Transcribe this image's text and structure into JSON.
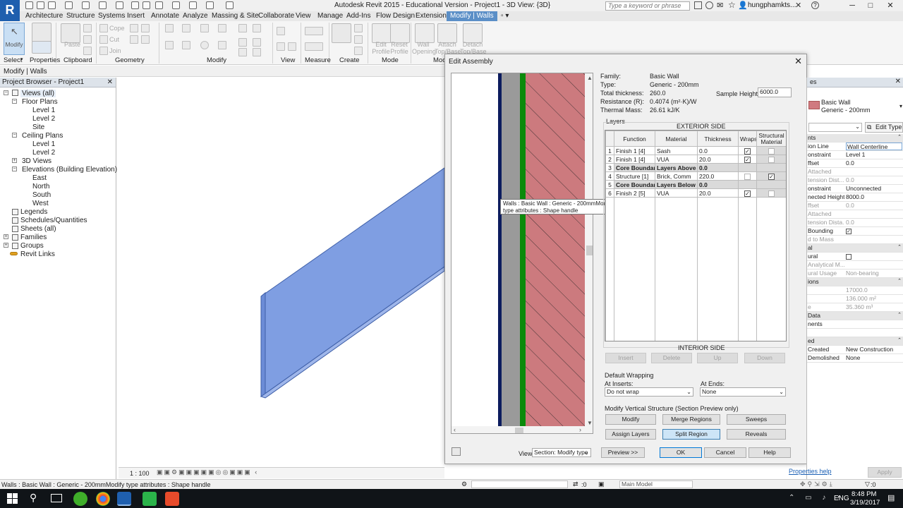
{
  "app": {
    "title": "Autodesk Revit 2015 - Educational Version -    Project1 - 3D View: {3D}",
    "search_placeholder": "Type a keyword or phrase",
    "user": "hungphamkts...",
    "brand_color": "#1f5fae"
  },
  "ribbon": {
    "tabs": [
      "Architecture",
      "Structure",
      "Systems",
      "Insert",
      "Annotate",
      "Analyze",
      "Massing & Site",
      "Collaborate",
      "View",
      "Manage",
      "Add-Ins",
      "Flow Design",
      "Extensions",
      "Modify | Walls"
    ],
    "active_tab": "Modify | Walls",
    "panels": [
      "Select",
      "Properties",
      "Clipboard",
      "Geometry",
      "Modify",
      "View",
      "Measure",
      "Create",
      "Mode",
      "Mod"
    ],
    "buttons": {
      "modify": "Modify",
      "paste": "Paste",
      "cope": "Cope",
      "cut": "Cut",
      "join": "Join",
      "edit_profile": "Edit Profile",
      "reset_profile": "Reset Profile",
      "wall_opening": "Wall Opening",
      "attach_top_base": "Attach Top/Base",
      "detach_top_base": "Detach Top/Base"
    }
  },
  "context_bar": {
    "label": "Modify | Walls"
  },
  "project_browser": {
    "title": "Project Browser - Project1",
    "items": [
      {
        "label": "Views (all)"
      },
      {
        "label": "Floor Plans"
      },
      {
        "label": "Level 1"
      },
      {
        "label": "Level 2"
      },
      {
        "label": "Site"
      },
      {
        "label": "Ceiling Plans"
      },
      {
        "label": "Level 1"
      },
      {
        "label": "Level 2"
      },
      {
        "label": "3D Views"
      },
      {
        "label": "Elevations (Building Elevation)"
      },
      {
        "label": "East"
      },
      {
        "label": "North"
      },
      {
        "label": "South"
      },
      {
        "label": "West"
      },
      {
        "label": "Legends"
      },
      {
        "label": "Schedules/Quantities"
      },
      {
        "label": "Sheets (all)"
      },
      {
        "label": "Families"
      },
      {
        "label": "Groups"
      },
      {
        "label": "Revit Links"
      }
    ]
  },
  "view_bar": {
    "scale": "1 : 100"
  },
  "dialog": {
    "title": "Edit Assembly",
    "family_label": "Family:",
    "family_value": "Basic Wall",
    "type_label": "Type:",
    "type_value": "Generic - 200mm",
    "thickness_label": "Total thickness:",
    "thickness_value": "260.0",
    "resistance_label": "Resistance (R):",
    "resistance_value": "0.4074 (m²·K)/W",
    "mass_label": "Thermal Mass:",
    "mass_value": "26.61 kJ/K",
    "sample_height_label": "Sample Height:",
    "sample_height_value": "6000.0",
    "layers_label": "Layers",
    "exterior_side": "EXTERIOR SIDE",
    "interior_side": "INTERIOR SIDE",
    "columns": [
      "Function",
      "Material",
      "Thickness",
      "Wraps",
      "Structural Material"
    ],
    "rows": [
      {
        "n": "1",
        "function": "Finish 1 [4]",
        "material": "Sash",
        "thickness": "0.0",
        "wraps": true,
        "structural": false,
        "bold": false
      },
      {
        "n": "2",
        "function": "Finish 1 [4]",
        "material": "VUA",
        "thickness": "20.0",
        "wraps": true,
        "structural": false,
        "bold": false
      },
      {
        "n": "3",
        "function": "Core Boundary",
        "material": "Layers Above",
        "thickness": "0.0",
        "wraps": null,
        "structural": null,
        "bold": true
      },
      {
        "n": "4",
        "function": "Structure [1]",
        "material": "Brick, Comm",
        "thickness": "220.0",
        "wraps": false,
        "structural": true,
        "bold": false
      },
      {
        "n": "5",
        "function": "Core Boundary",
        "material": "Layers Below",
        "thickness": "0.0",
        "wraps": null,
        "structural": null,
        "bold": true
      },
      {
        "n": "6",
        "function": "Finish 2 [5]",
        "material": "VUA",
        "thickness": "20.0",
        "wraps": true,
        "structural": false,
        "bold": false
      }
    ],
    "layer_buttons": [
      "Insert",
      "Delete",
      "Up",
      "Down"
    ],
    "default_wrapping_label": "Default Wrapping",
    "at_inserts_label": "At Inserts:",
    "at_inserts_value": "Do not wrap",
    "at_ends_label": "At Ends:",
    "at_ends_value": "None",
    "vertical_label": "Modify Vertical Structure (Section Preview only)",
    "vertical_buttons": [
      "Modify",
      "Merge Regions",
      "Sweeps",
      "Assign Layers",
      "Split Region",
      "Reveals"
    ],
    "view_label": "View:",
    "view_value": "Section: Modify type",
    "preview_btn": "Preview >>",
    "ok": "OK",
    "cancel": "Cancel",
    "help": "Help",
    "tooltip": "Walls : Basic Wall : Generic - 200mmModify type attributes : Shape handle",
    "layer_colors": {
      "finish": "#0c1c5e",
      "gray": "#9a9a9a",
      "green": "#0b8a0b",
      "brick": "#cc7a7e"
    }
  },
  "properties": {
    "type_line1": "Basic Wall",
    "type_line2": "Generic - 200mm",
    "edit_type": "Edit Type",
    "rows": [
      {
        "k": "nts",
        "v": "",
        "section": true
      },
      {
        "k": "ion Line",
        "v": "Wall Centerline"
      },
      {
        "k": "onstraint",
        "v": "Level 1"
      },
      {
        "k": "ffset",
        "v": "0.0"
      },
      {
        "k": "Attached",
        "v": "",
        "gray": true
      },
      {
        "k": "tension Dist...",
        "v": "0.0",
        "gray": true
      },
      {
        "k": "onstraint",
        "v": "Unconnected"
      },
      {
        "k": "nected Height",
        "v": "8000.0"
      },
      {
        "k": "ffset",
        "v": "0.0",
        "gray": true
      },
      {
        "k": "Attached",
        "v": "",
        "gray": true
      },
      {
        "k": "tension Dista...",
        "v": "0.0",
        "gray": true
      },
      {
        "k": "Bounding",
        "v": "check"
      },
      {
        "k": "d to Mass",
        "v": "",
        "gray": true
      },
      {
        "k": "al",
        "v": "",
        "section": true
      },
      {
        "k": "ural",
        "v": "box"
      },
      {
        "k": "Analytical M...",
        "v": "",
        "gray": true
      },
      {
        "k": "ural Usage",
        "v": "Non-bearing",
        "gray": true
      },
      {
        "k": "ions",
        "v": "",
        "section": true
      },
      {
        "k": "",
        "v": "17000.0",
        "gray": true
      },
      {
        "k": "",
        "v": "136.000 m²",
        "gray": true
      },
      {
        "k": "e",
        "v": "35.360 m³",
        "gray": true
      },
      {
        "k": "Data",
        "v": "",
        "section": true
      },
      {
        "k": "nents",
        "v": ""
      },
      {
        "k": "",
        "v": ""
      },
      {
        "k": "ed",
        "v": "",
        "section": true
      },
      {
        "k": "Created",
        "v": "New Construction"
      },
      {
        "k": "Demolished",
        "v": "None"
      }
    ],
    "help_link": "Properties help",
    "apply": "Apply"
  },
  "status": {
    "text": "Walls : Basic Wall : Generic - 200mmModify type attributes : Shape handle",
    "zero": ":0",
    "model": "Main Model"
  },
  "taskbar": {
    "lang": "ENG",
    "time": "8:48 PM",
    "date": "3/19/2017"
  }
}
